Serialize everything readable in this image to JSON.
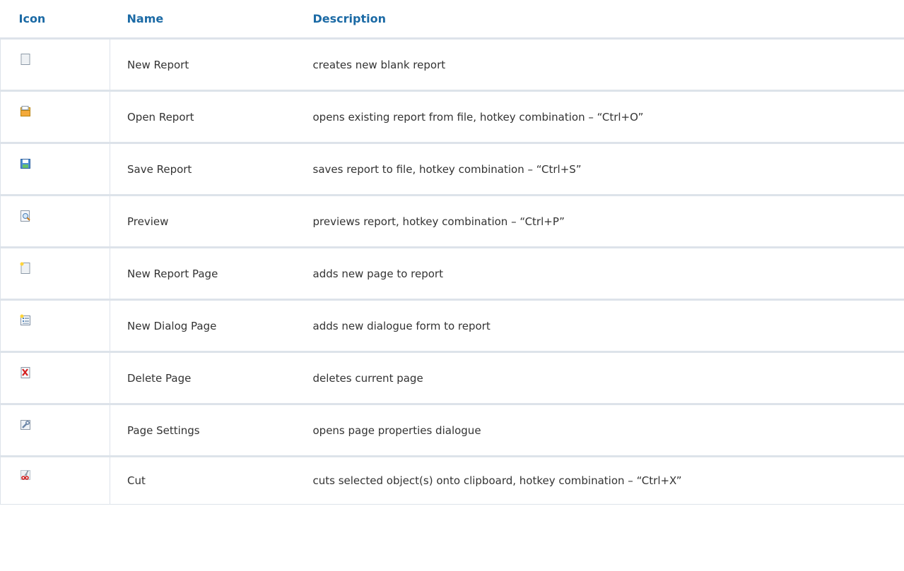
{
  "headers": {
    "icon": "Icon",
    "name": "Name",
    "description": "Description"
  },
  "rows": [
    {
      "icon": "new-report-icon",
      "name": "New Report",
      "description": "creates new blank report"
    },
    {
      "icon": "open-report-icon",
      "name": "Open Report",
      "description": "opens existing report from file, hotkey combination – “Ctrl+O”"
    },
    {
      "icon": "save-report-icon",
      "name": "Save Report",
      "description": "saves report to file, hotkey combination – “Ctrl+S”"
    },
    {
      "icon": "preview-icon",
      "name": "Preview",
      "description": "previews report, hotkey combination – “Ctrl+P”"
    },
    {
      "icon": "new-report-page-icon",
      "name": "New Report Page",
      "description": "adds new page to report"
    },
    {
      "icon": "new-dialog-page-icon",
      "name": "New Dialog Page",
      "description": "adds new dialogue form to report"
    },
    {
      "icon": "delete-page-icon",
      "name": "Delete Page",
      "description": "deletes current page"
    },
    {
      "icon": "page-settings-icon",
      "name": "Page Settings",
      "description": "opens page properties dialogue"
    },
    {
      "icon": "cut-icon",
      "name": "Cut",
      "description": "cuts selected object(s) onto clipboard, hotkey combination – “Ctrl+X”"
    }
  ]
}
